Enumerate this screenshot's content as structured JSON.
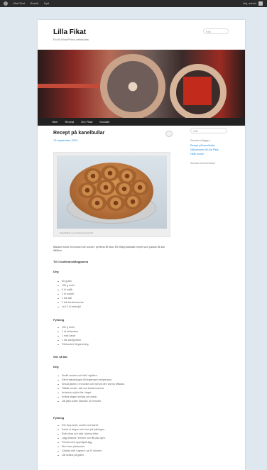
{
  "adminbar": {
    "items": [
      "Lilla Fikat",
      "Besök",
      "Nytt"
    ],
    "right_label": "Hej, admin"
  },
  "site": {
    "title": "Lilla Fikat",
    "description": "En till WordPress-webbplats",
    "search_placeholder": "Sök"
  },
  "nav": {
    "items": [
      "Hem",
      "Recept",
      "Om Fikat",
      "Kontakt"
    ]
  },
  "entry": {
    "title": "Recept på kanelbullar",
    "meta": "12 september 2012",
    "caption": "Kanelbullar i en rund form på ett fat",
    "intro": "Bakade bullar med kanel och socker, perfekta till fikat. Ett riktigt klassiskt recept som passar till alla tillfällen.",
    "sections": [
      {
        "heading": "Till 1 bullkrans/långpanna",
        "sub": "Deg",
        "items": [
          "50 g jäst",
          "150 g smör",
          "5 dl mjölk",
          "1 dl socker",
          "1 tsk salt",
          "2 tsk kardemumma",
          "ca 13 dl vetemjöl"
        ]
      },
      {
        "heading": "Fyllning",
        "items": [
          "100 g smör",
          "1 dl strösocker",
          "1 msk kanel",
          "1 tsk vaniljsocker",
          "Pärlsocker till garnering"
        ]
      },
      {
        "heading": "Gör så här",
        "sub": "Deg",
        "items": [
          "Smält smöret och häll i mjölken.",
          "Värm blandningen till fingervarm temperatur.",
          "Smula jästen i en bunke och häll på den varma vätskan.",
          "Tillsätt socker, salt och kardemumma.",
          "Arbeta in mjölet lite i taget.",
          "Knåda degen smidig och blank.",
          "Låt jäsa under bakduk i 30 minuter."
        ]
      },
      {
        "heading": "Fyllning",
        "items": [
          "Rör ihop smör, socker och kanel.",
          "Kavla ut degen och bred på fyllningen.",
          "Rulla ihop och skär i jämna bitar.",
          "Lägg bitarna i formen och låt jäsa igen.",
          "Pensla med uppvispat ägg.",
          "Strö över pärlsocker.",
          "Grädda mitt i ugnen i ca 20 minuter.",
          "Låt svalna på galler."
        ]
      }
    ]
  },
  "sidebar": {
    "search_placeholder": "Sök",
    "recent_heading": "Senaste inläggen",
    "recent_links": [
      "Recept på kanelbullar",
      "Välkommen till Lilla Fikat",
      "Hello world!"
    ],
    "meta_heading": "Senaste kommentarer"
  }
}
